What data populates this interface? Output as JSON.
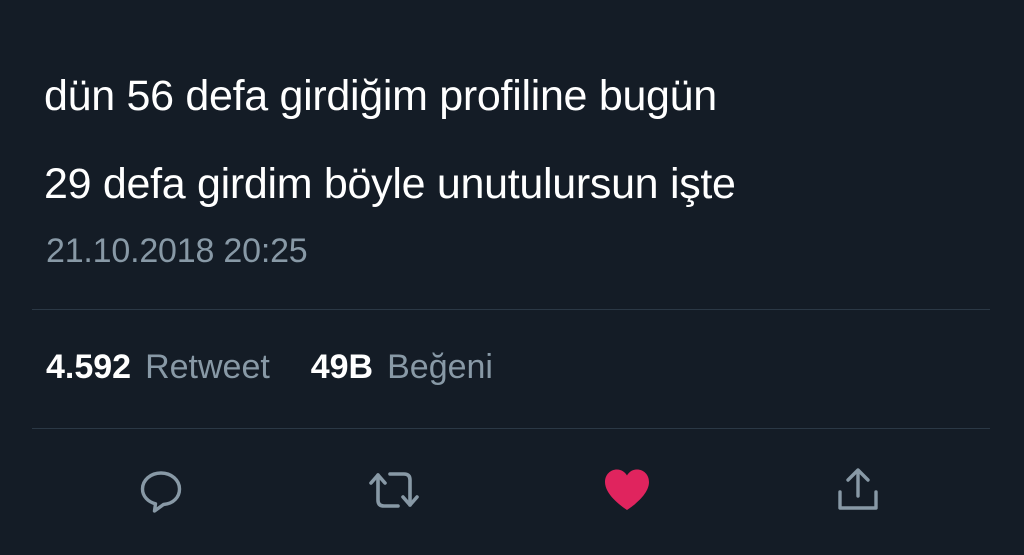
{
  "tweet": {
    "text_lines": [
      "dün 56 defa girdiğim profiline bugün",
      "29 defa girdim böyle unutulursun işte"
    ],
    "timestamp": "21.10.2018 20:25"
  },
  "stats": {
    "retweet_count": "4.592",
    "retweet_label": "Retweet",
    "like_count": "49B",
    "like_label": "Beğeni"
  },
  "actions": {
    "reply_icon": "reply-icon",
    "retweet_icon": "retweet-icon",
    "like_icon": "heart-icon",
    "share_icon": "share-icon",
    "liked": true
  },
  "colors": {
    "background": "#141c26",
    "text": "#ffffff",
    "muted": "#8899a6",
    "divider": "#2b3845",
    "like": "#e0245e"
  }
}
